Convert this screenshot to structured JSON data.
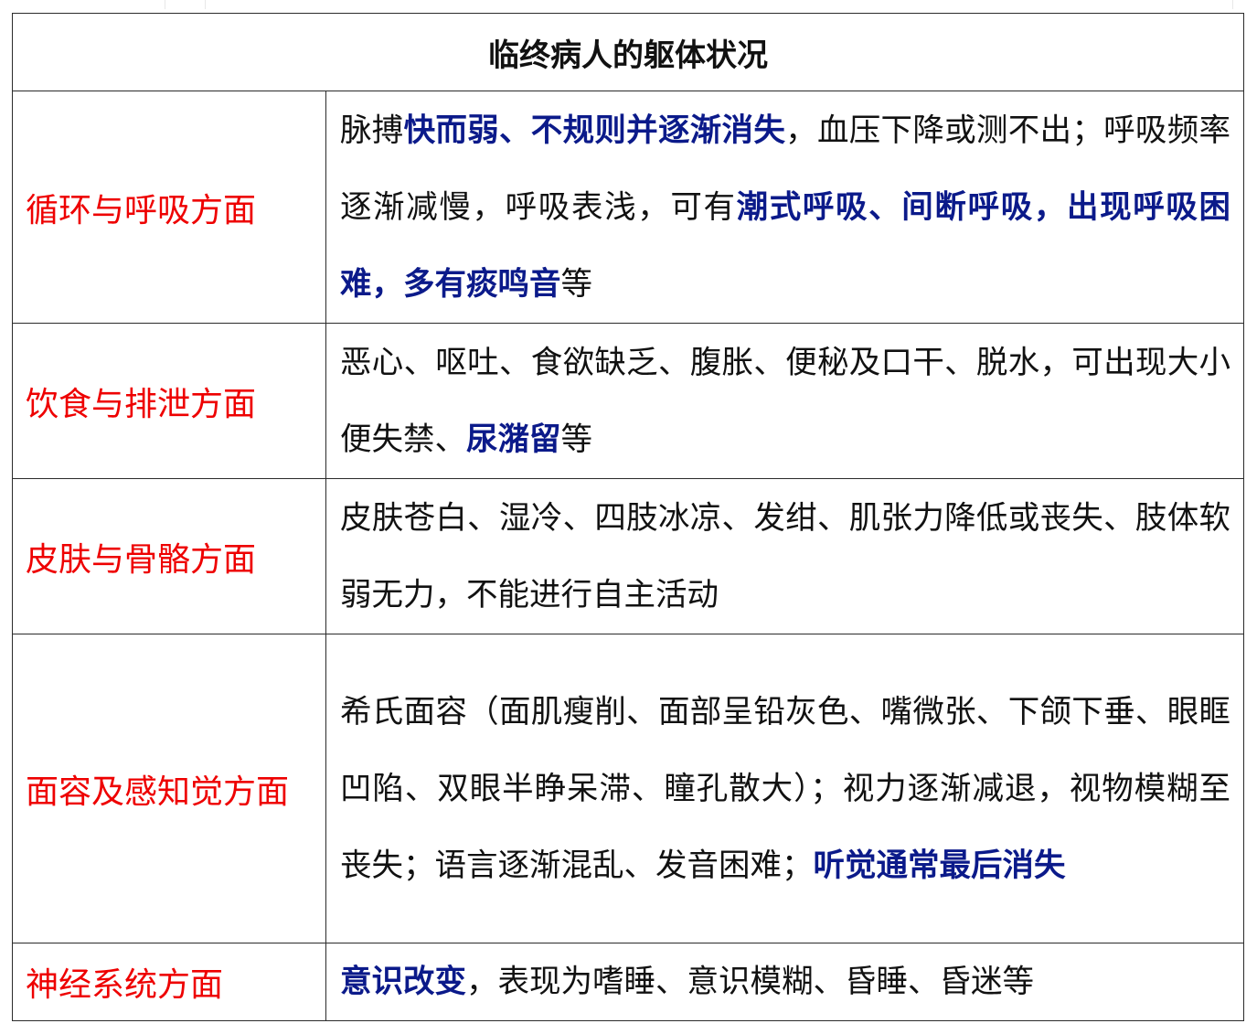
{
  "table": {
    "title": "临终病人的躯体状况",
    "rows": [
      {
        "category": "循环与呼吸方面",
        "segments": [
          {
            "text": "脉搏",
            "highlight": false
          },
          {
            "text": "快而弱、不规则并逐渐消失",
            "highlight": true
          },
          {
            "text": "，血压下降或测不出；呼吸频率逐渐减慢，呼吸表浅，可有",
            "highlight": false
          },
          {
            "text": "潮式呼吸、间断呼吸，出现呼吸困难，多有痰鸣音",
            "highlight": true
          },
          {
            "text": "等",
            "highlight": false
          }
        ]
      },
      {
        "category": "饮食与排泄方面",
        "segments": [
          {
            "text": "恶心、呕吐、食欲缺乏、腹胀、便秘及口干、脱水，可出现大小便失禁、",
            "highlight": false
          },
          {
            "text": "尿潴留",
            "highlight": true
          },
          {
            "text": "等",
            "highlight": false
          }
        ]
      },
      {
        "category": "皮肤与骨骼方面",
        "segments": [
          {
            "text": "皮肤苍白、湿冷、四肢冰凉、发绀、肌张力降低或丧失、肢体软弱无力，不能进行自主活动",
            "highlight": false
          }
        ]
      },
      {
        "category": "面容及感知觉方面",
        "segments": [
          {
            "text": "希氏面容（面肌瘦削、面部呈铅灰色、嘴微张、下颌下垂、眼眶凹陷、双眼半睁呆滞、瞳孔散大）；视力逐渐减退，视物模糊至丧失；语言逐渐混乱、发音困难；",
            "highlight": false
          },
          {
            "text": "听觉通常最后消失",
            "highlight": true
          }
        ]
      },
      {
        "category": "神经系统方面",
        "segments": [
          {
            "text": "意识改变",
            "highlight": true
          },
          {
            "text": "，表现为嗜睡、意识模糊、昏睡、昏迷等",
            "highlight": false
          }
        ]
      }
    ]
  },
  "colors": {
    "category_text": "#ee0000",
    "highlight_text": "#0b1a8a",
    "body_text": "#111111",
    "border": "#2b2b2b"
  }
}
